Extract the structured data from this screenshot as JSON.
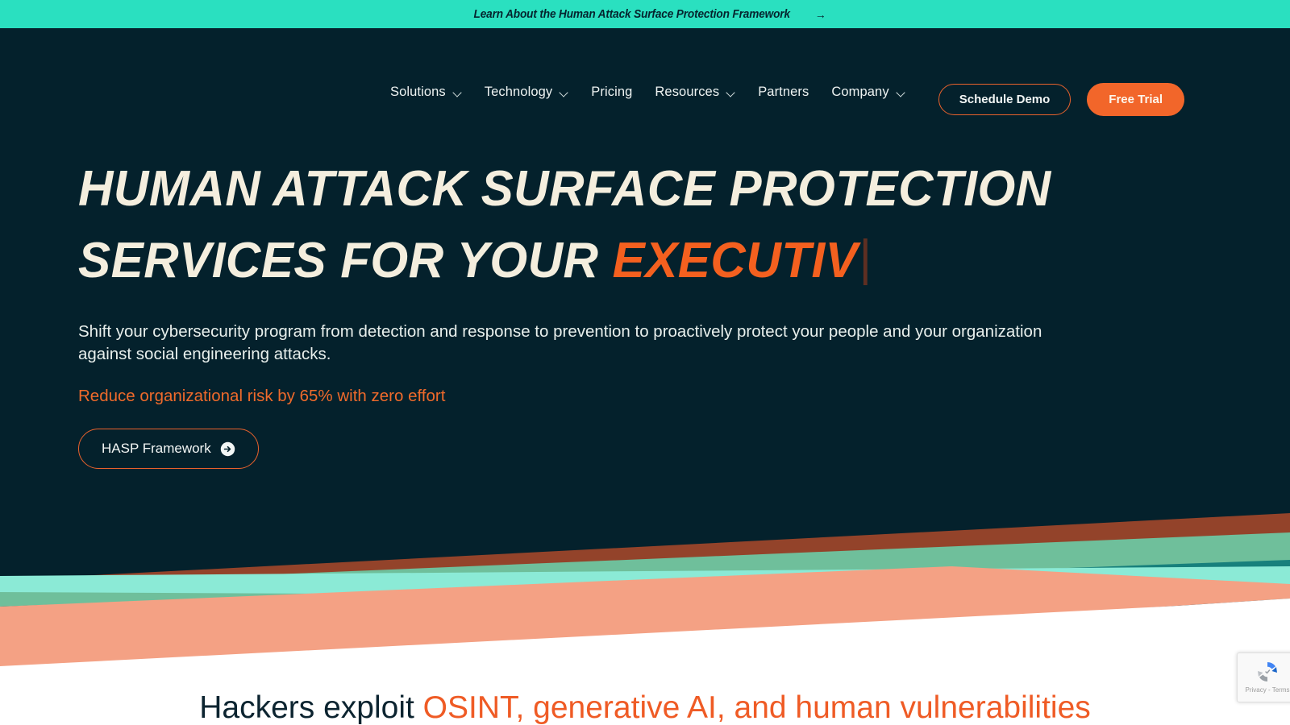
{
  "announcement": {
    "text": "Learn About the Human Attack Surface Protection Framework",
    "arrow": "→",
    "background_color": "#2ae0c0",
    "text_color": "#05242e"
  },
  "nav": {
    "items": [
      {
        "label": "Solutions",
        "has_dropdown": true
      },
      {
        "label": "Technology",
        "has_dropdown": true
      },
      {
        "label": "Pricing",
        "has_dropdown": false
      },
      {
        "label": "Resources",
        "has_dropdown": true
      },
      {
        "label": "Partners",
        "has_dropdown": false
      },
      {
        "label": "Company",
        "has_dropdown": true
      }
    ],
    "actions": {
      "schedule_demo": "Schedule Demo",
      "free_trial": "Free Trial"
    }
  },
  "hero": {
    "headline_line1": "HUMAN ATTACK SURFACE PROTECTION",
    "headline_line2_static": "SERVICES FOR YOUR ",
    "headline_line2_typed": "EXECUTIV",
    "subcopy": "Shift your cybersecurity program from detection and response to prevention to proactively protect your people and your organization against social engineering attacks.",
    "risk_line": "Reduce organizational risk by 65% with zero effort",
    "cta_label": "HASP Framework",
    "background_color": "#04212c",
    "headline_color": "#f4eede",
    "accent_color": "#f4601f"
  },
  "below_section": {
    "heading_static": "Hackers exploit ",
    "heading_accent": "OSINT, generative AI, and human vulnerabilities"
  },
  "recaptcha": {
    "terms": "Privacy - Terms"
  },
  "theme": {
    "teal": "#2ae0c0",
    "orange": "#f2662a",
    "dark_navy": "#04212c",
    "cream": "#f4eede",
    "salmon": "#f4a184",
    "mint": "#7fc8a9",
    "deep_teal": "#1a7a77",
    "brown": "#93432a"
  }
}
